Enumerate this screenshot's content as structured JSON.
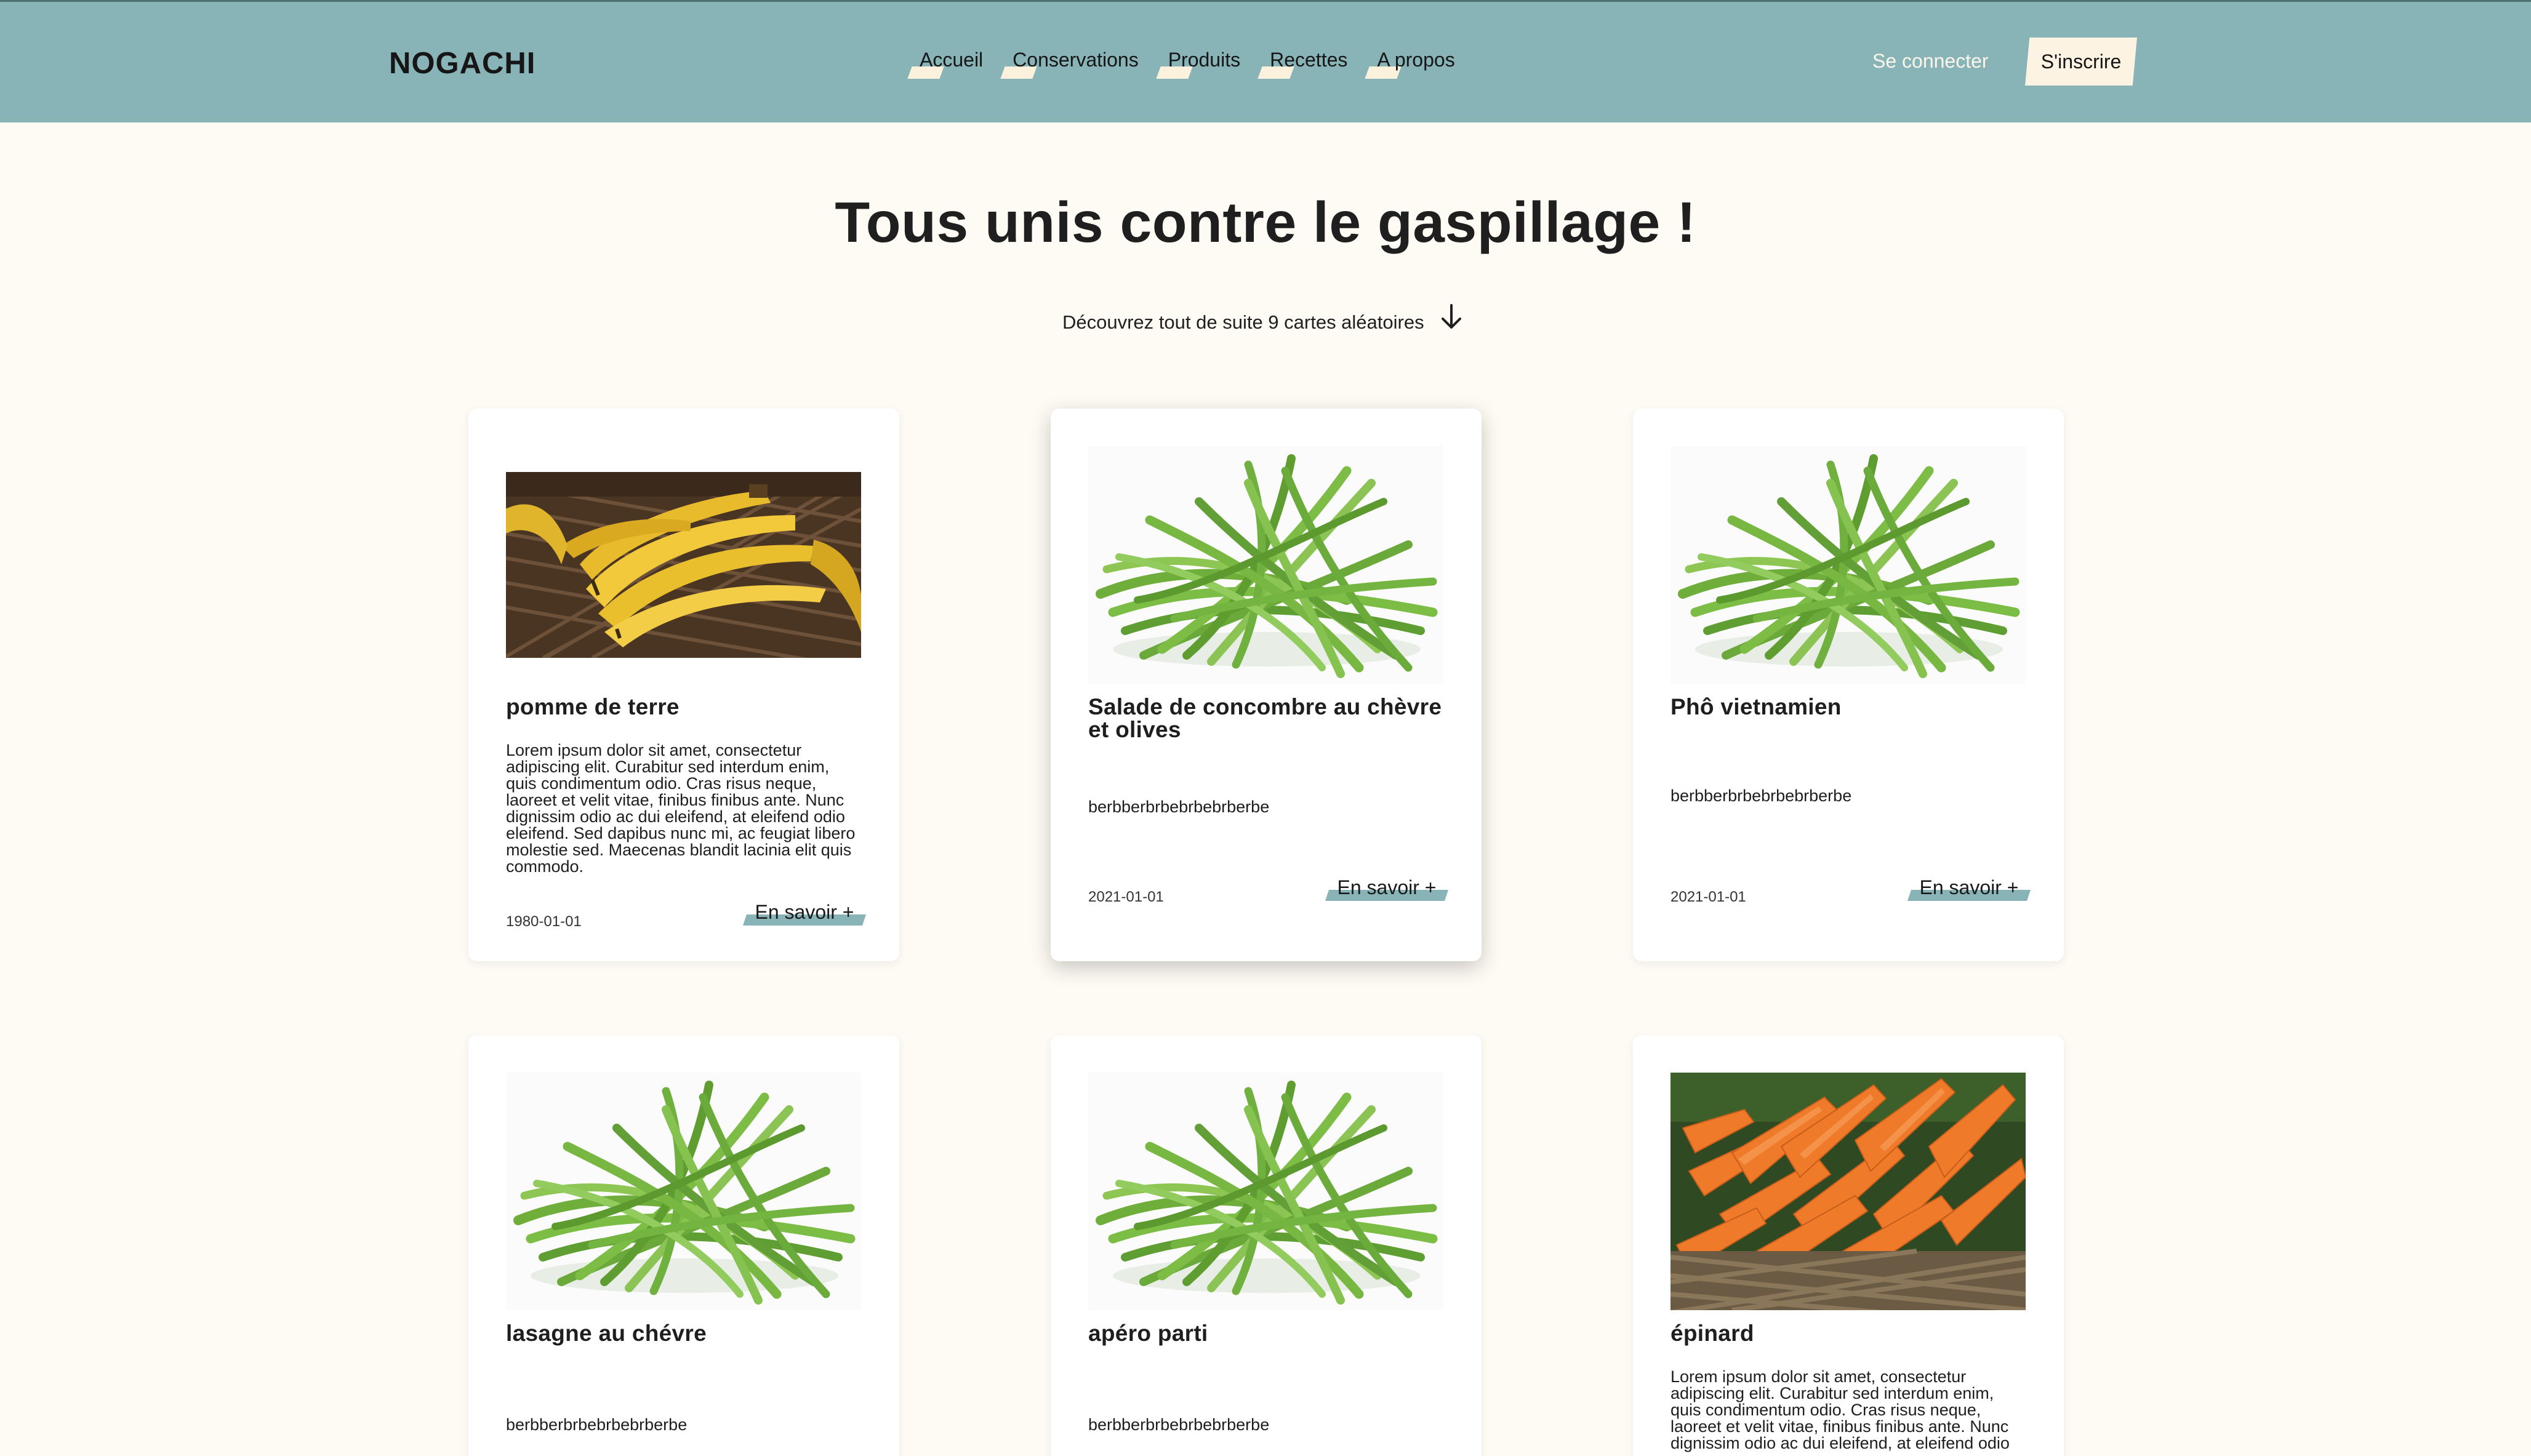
{
  "header": {
    "logo": "NOGACHI",
    "nav": [
      "Accueil",
      "Conservations",
      "Produits",
      "Recettes",
      "A propos"
    ],
    "login_label": "Se connecter",
    "signup_label": "S'inscrire"
  },
  "hero": {
    "title": "Tous unis contre le gaspillage !",
    "subtitle": "Découvrez tout de suite 9 cartes aléatoires"
  },
  "cards": [
    {
      "image": "bananas",
      "title": "pomme de terre",
      "description": "Lorem ipsum dolor sit amet, consectetur adipiscing elit. Curabitur sed interdum enim, quis condimentum odio. Cras risus neque, laoreet et velit vitae, finibus finibus ante. Nunc dignissim odio ac dui eleifend, at eleifend odio eleifend. Sed dapibus nunc mi, ac feugiat libero molestie sed. Maecenas blandit lacinia elit quis commodo.",
      "date": "1980-01-01",
      "more_label": "En savoir +"
    },
    {
      "image": "green-beans",
      "title": "Salade de concombre au chèvre et olives",
      "description": "berbberbrbebrbebrberbe",
      "date": "2021-01-01",
      "more_label": "En savoir +"
    },
    {
      "image": "green-beans",
      "title": "Phô vietnamien",
      "description": "berbberbrbebrbebrberbe",
      "date": "2021-01-01",
      "more_label": "En savoir +"
    },
    {
      "image": "green-beans",
      "title": "lasagne au chévre",
      "description": "berbberbrbebrbebrberbe"
    },
    {
      "image": "green-beans",
      "title": "apéro parti",
      "description": "berbberbrbebrbebrberbe"
    },
    {
      "image": "carrots",
      "title": "épinard",
      "description": "Lorem ipsum dolor sit amet, consectetur adipiscing elit. Curabitur sed interdum enim, quis condimentum odio. Cras risus neque, laoreet et velit vitae, finibus finibus ante. Nunc dignissim odio ac dui eleifend, at eleifend odio"
    }
  ],
  "colors": {
    "header_bg": "#88b4b7",
    "page_bg": "#fefbf4",
    "accent_cream": "#fcf3e3"
  }
}
